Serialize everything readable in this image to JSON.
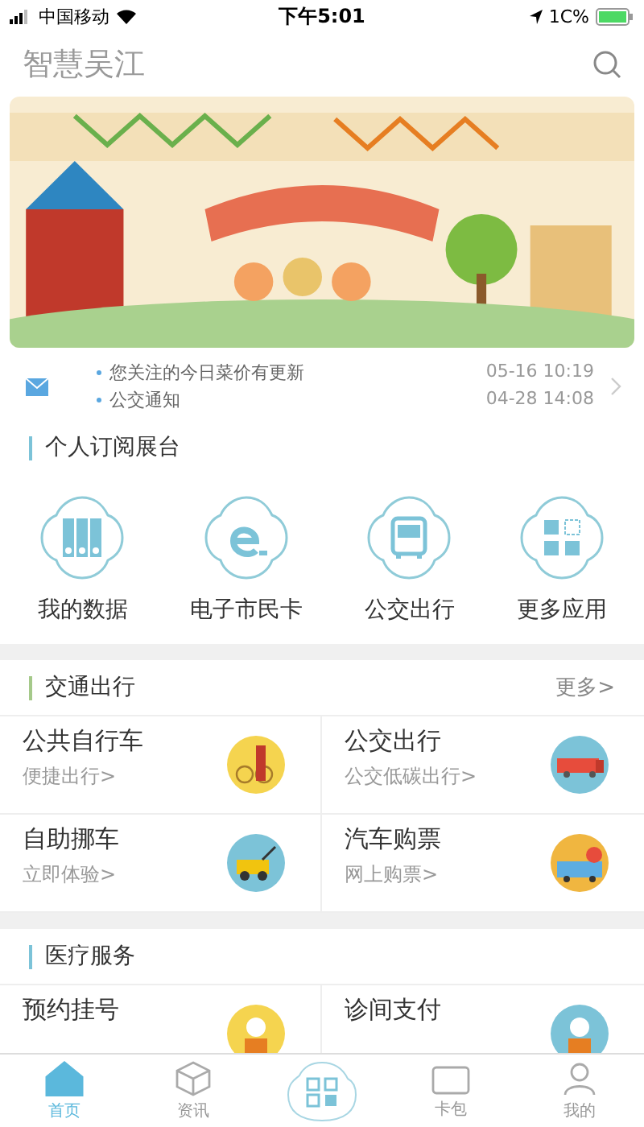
{
  "status_bar": {
    "carrier": "中国移动",
    "time": "下午5:01",
    "battery": "1C%"
  },
  "header": {
    "title": "智慧吴江"
  },
  "notices": [
    {
      "text": "您关注的今日菜价有更新",
      "time": "05-16 10:19"
    },
    {
      "text": "公交通知",
      "time": "04-28 14:08"
    }
  ],
  "subscriptions": {
    "title": "个人订阅展台",
    "items": [
      {
        "label": "我的数据",
        "kind": "data"
      },
      {
        "label": "电子市民卡",
        "kind": "card"
      },
      {
        "label": "公交出行",
        "kind": "bus"
      },
      {
        "label": "更多应用",
        "kind": "more"
      }
    ]
  },
  "sections": [
    {
      "title": "交通出行",
      "more": "更多>",
      "color": "#a5c98a",
      "items": [
        {
          "title": "公共自行车",
          "subtitle": "便捷出行>",
          "kind": "bike"
        },
        {
          "title": "公交出行",
          "subtitle": "公交低碳出行>",
          "kind": "truck"
        },
        {
          "title": "自助挪车",
          "subtitle": "立即体验>",
          "kind": "tow"
        },
        {
          "title": "汽车购票",
          "subtitle": "网上购票>",
          "kind": "coach"
        }
      ]
    },
    {
      "title": "医疗服务",
      "color": "#7cc3d8",
      "items": [
        {
          "title": "预约挂号",
          "kind": "doctor"
        },
        {
          "title": "诊间支付",
          "kind": "pay"
        }
      ]
    }
  ],
  "tab_bar": [
    {
      "label": "首页",
      "kind": "home",
      "selected": true
    },
    {
      "label": "资讯",
      "kind": "news",
      "selected": false
    },
    {
      "kind": "scan",
      "selected": false
    },
    {
      "label": "卡包",
      "kind": "wallet",
      "selected": false
    },
    {
      "label": "我的",
      "kind": "me",
      "selected": false
    }
  ]
}
